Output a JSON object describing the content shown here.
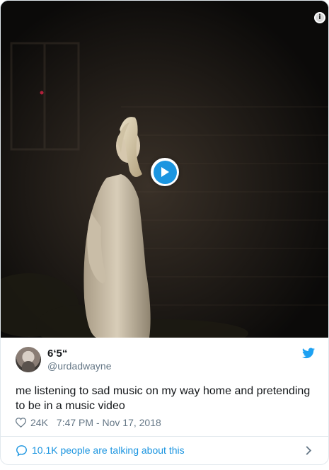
{
  "tweet": {
    "display_name": "6‘5“",
    "handle": "@urdadwayne",
    "text": "me listening to sad music on my way home and pretending to be in a music video",
    "like_count": "24K",
    "timestamp": "7:47 PM - Nov 17, 2018",
    "conversation_label": "10.1K people are talking about this"
  },
  "video": {
    "info_glyph": "i"
  },
  "icons": {
    "info": "info-icon",
    "play": "play-icon",
    "twitter": "twitter-bird-icon",
    "like": "heart-icon",
    "conversation": "speech-bubble-icon",
    "chevron": "chevron-right-icon"
  },
  "colors": {
    "accent": "#1b95e0",
    "text_primary": "#14171a",
    "text_secondary": "#657786",
    "border": "#e1e8ed"
  }
}
